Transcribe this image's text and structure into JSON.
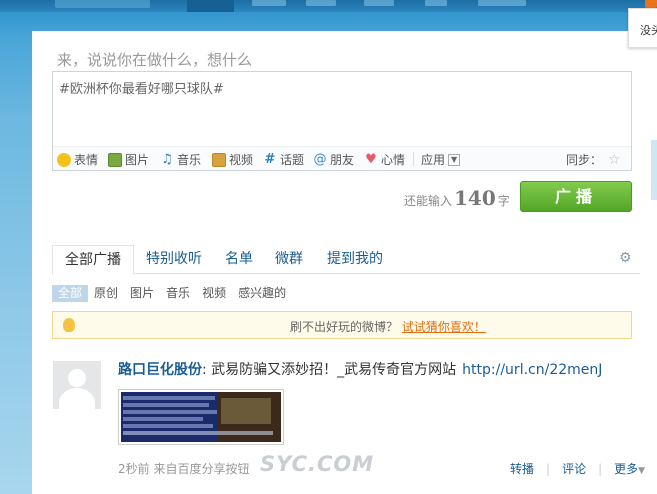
{
  "corner_note": {
    "text": "没头"
  },
  "composer": {
    "prompt": "来，说说你在做什么，想什么",
    "value": "#欧洲杯你最看好哪只球队#",
    "tools": [
      {
        "icon": "emoji-icon",
        "label": "表情"
      },
      {
        "icon": "picture-icon",
        "label": "图片"
      },
      {
        "icon": "music-icon",
        "label": "音乐"
      },
      {
        "icon": "video-icon",
        "label": "视频"
      },
      {
        "icon": "topic-icon",
        "label": "话题"
      },
      {
        "icon": "at-friend-icon",
        "label": "朋友"
      },
      {
        "icon": "heart-icon",
        "label": "心情"
      }
    ],
    "app_label": "应用",
    "sync_label": "同步：",
    "remain_prefix": "还能输入",
    "remain_count": "140",
    "remain_suffix": "字",
    "post_button": "广播"
  },
  "tabs": [
    {
      "label": "全部广播",
      "active": true
    },
    {
      "label": "特别收听"
    },
    {
      "label": "名单"
    },
    {
      "label": "微群"
    },
    {
      "label": "提到我的"
    }
  ],
  "subtabs": [
    {
      "label": "全部",
      "active": true
    },
    {
      "label": "原创"
    },
    {
      "label": "图片"
    },
    {
      "label": "音乐"
    },
    {
      "label": "视频"
    },
    {
      "label": "感兴趣的"
    }
  ],
  "notice": {
    "text": "刷不出好玩的微博？",
    "link": "试试猜你喜欢！"
  },
  "post": {
    "author": "路口巨化股份",
    "colon": ":",
    "content": " 武易防骗又添妙招！_武易传奇官方网站",
    "url": "http://url.cn/22menJ",
    "time": "2秒前",
    "source": "来自百度分享按钮",
    "actions": {
      "repost": "转播",
      "comment": "评论",
      "more": "更多"
    }
  },
  "watermark": "SYC.COM",
  "colors": {
    "accent": "#1a5d93",
    "post_button": "#53a626",
    "notice_link": "#e76c0e"
  }
}
